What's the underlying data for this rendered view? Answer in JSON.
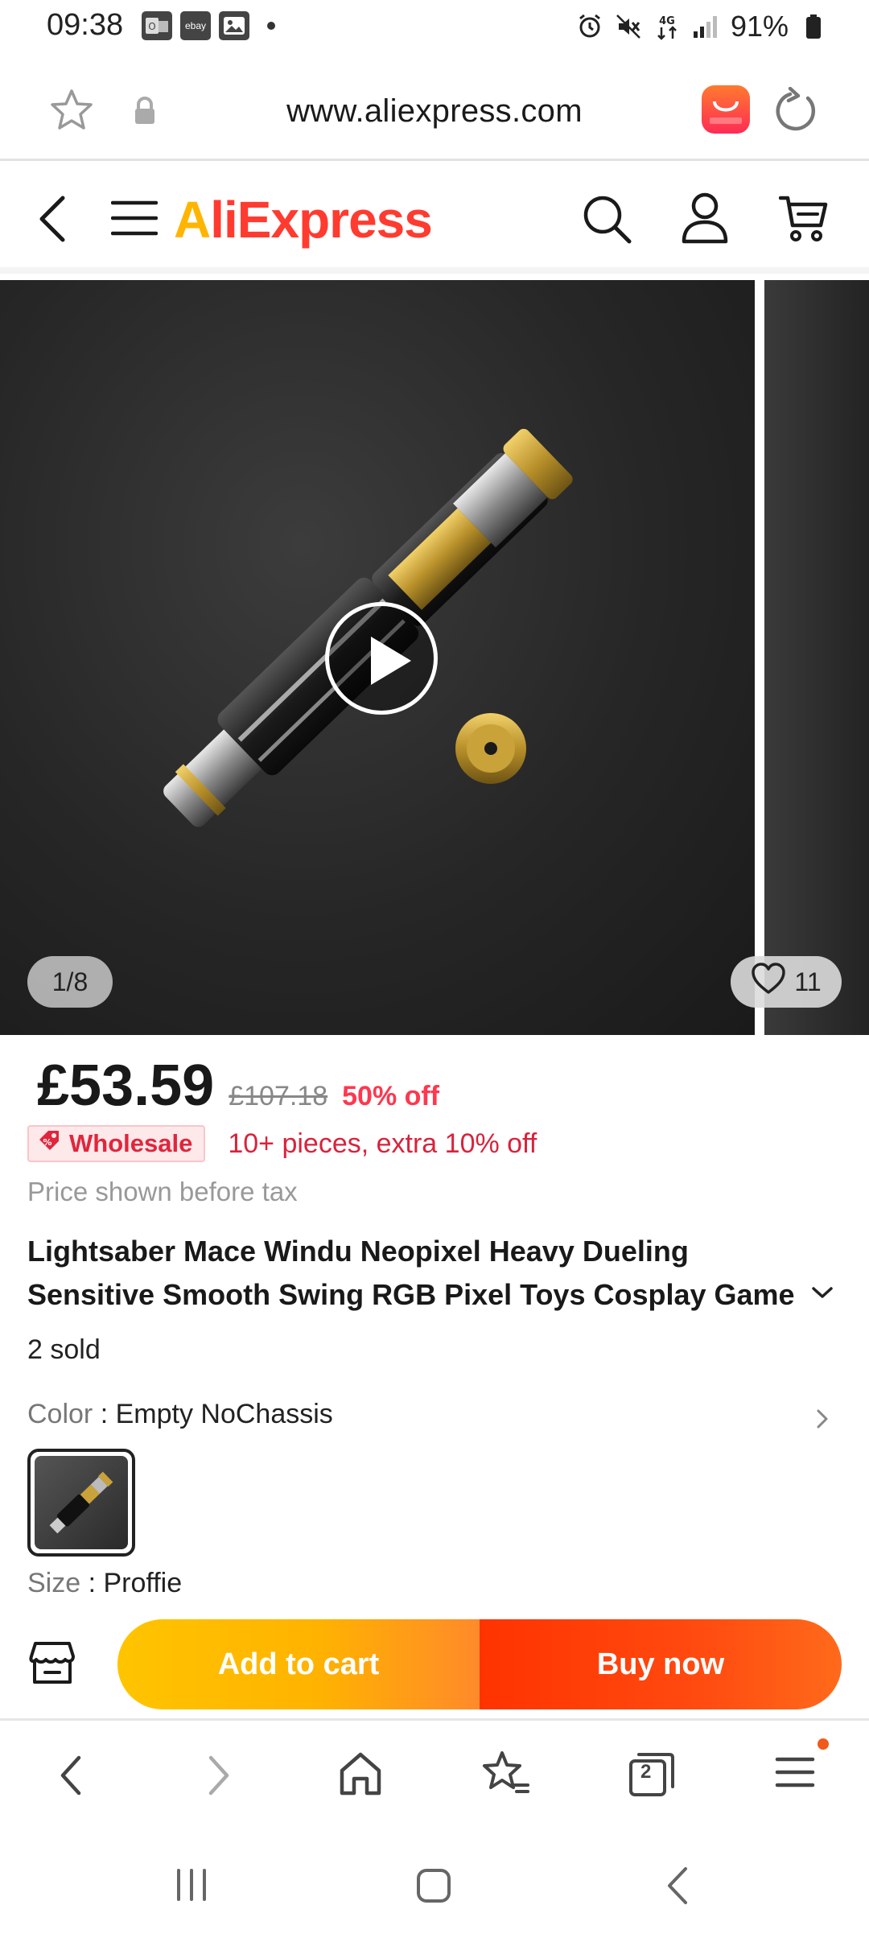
{
  "status_bar": {
    "time": "09:38",
    "notification_icons": [
      "outlook-icon",
      "ebay-icon",
      "gallery-icon"
    ],
    "notif_ebay_text": "ebay",
    "network_label": "4G",
    "battery": "91%"
  },
  "browser": {
    "url": "www.aliexpress.com",
    "tab_count": "2"
  },
  "header": {
    "brand_prefix": "A",
    "brand_rest": "liExpress"
  },
  "gallery": {
    "counter": "1/8",
    "wishlist_count": "11"
  },
  "product": {
    "price": "£53.59",
    "original_price": "£107.18",
    "discount": "50% off",
    "wholesale_label": "Wholesale",
    "wholesale_offer": "10+ pieces, extra 10% off",
    "tax_note": "Price shown before tax",
    "title": "Lightsaber Mace Windu Neopixel Heavy Dueling Sensitive Smooth Swing RGB Pixel Toys Cosplay Game",
    "sold": "2 sold",
    "color_label": "Color",
    "color_separator": " : ",
    "color_value": "Empty NoChassis",
    "size_label": "Size",
    "size_separator": " : ",
    "size_value": "Proffie"
  },
  "actions": {
    "add_to_cart": "Add to cart",
    "buy_now": "Buy now"
  },
  "colors": {
    "brand_red": "#ff3b30",
    "brand_orange": "#ffb400",
    "discount_red": "#fd384f",
    "cart_yellow": "#ffc400",
    "buy_orange": "#ff3300"
  }
}
